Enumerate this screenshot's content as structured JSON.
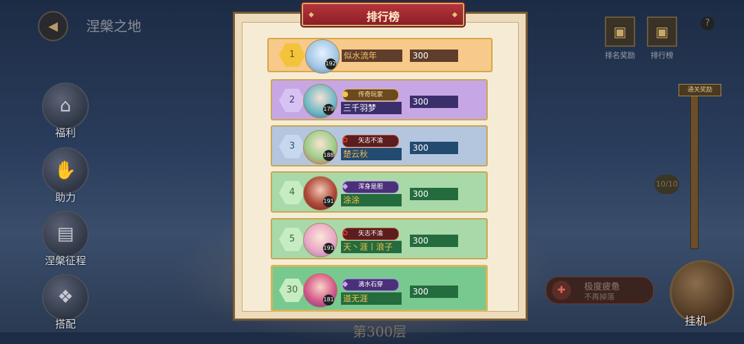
{
  "header": {
    "title": "涅槃之地",
    "back_icon": "back-icon"
  },
  "left_menu": [
    {
      "label": "福利",
      "icon": "house-icon"
    },
    {
      "label": "助力",
      "icon": "handshake-icon"
    },
    {
      "label": "涅槃征程",
      "icon": "map-icon"
    },
    {
      "label": "搭配",
      "icon": "cards-icon"
    }
  ],
  "right_top": [
    {
      "label": "排名奖励",
      "icon": "gift-icon"
    },
    {
      "label": "排行榜",
      "icon": "gift-icon"
    }
  ],
  "help_label": "?",
  "progress": {
    "cap_label": "通关奖励",
    "count": "10/10"
  },
  "speed": {
    "title": "极度疲惫",
    "subtitle": "不再掉落"
  },
  "hangup_label": "挂机",
  "floor_label": "第300层",
  "panel": {
    "title": "排行榜",
    "rows": [
      {
        "rank": "1",
        "level": "192",
        "name": "似水流年",
        "score": "300",
        "badge": ""
      },
      {
        "rank": "2",
        "level": "179",
        "name": "三千羽梦",
        "score": "300",
        "badge": "传奇玩家"
      },
      {
        "rank": "3",
        "level": "188",
        "name": "楚云秋",
        "score": "300",
        "badge": "矢志不渝"
      },
      {
        "rank": "4",
        "level": "191",
        "name": "涂涂",
        "score": "300",
        "badge": "浑身是胆"
      },
      {
        "rank": "5",
        "level": "191",
        "name": "天丶涯丨浪子",
        "score": "300",
        "badge": "矢志不渝"
      },
      {
        "rank": "30",
        "level": "181",
        "name": "道无涯",
        "score": "300",
        "badge": "滴水石穿"
      }
    ]
  },
  "colors": {
    "row1": "#f7c98a",
    "row2": "#c7a6e6",
    "row3": "#b4c6de",
    "row4": "#a9d9a8",
    "row5": "#a9d9a8",
    "row6": "#78c98f",
    "accent": "#b5353a"
  }
}
